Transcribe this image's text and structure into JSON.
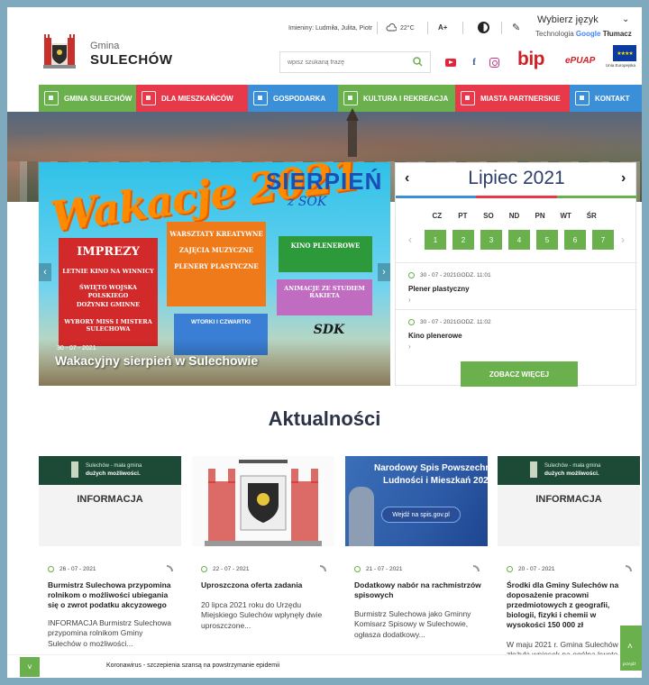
{
  "header": {
    "gmina_label": "Gmina",
    "gmina_name": "SULECHÓW",
    "nameday": "Imieniny: Ludmiła, Julita, Piotr",
    "temperature": "22°C",
    "font_size_label": "A+",
    "language_select": "Wybierz język",
    "translate_prefix": "Technologia ",
    "translate_google": "Google",
    "translate_tlumacz": " Tłumacz",
    "search_placeholder": "wpisz szukaną frazę",
    "bip_label": "bip",
    "epuap_label": "ePUAP",
    "eu_label": "Unia Europejska"
  },
  "nav": [
    {
      "label": "GMINA SULECHÓW",
      "color": "#6ab04c"
    },
    {
      "label": "DLA MIESZKAŃCÓW",
      "color": "#e8394a"
    },
    {
      "label": "GOSPODARKA",
      "color": "#3a8fd8"
    },
    {
      "label": "KULTURA I REKREACJA",
      "color": "#6ab04c"
    },
    {
      "label": "MIASTA PARTNERSKIE",
      "color": "#e8394a"
    },
    {
      "label": "KONTAKT",
      "color": "#3a8fd8"
    }
  ],
  "slider": {
    "title": "Wakacje 2021",
    "month": "SIERPIEŃ",
    "sok": "z SOK",
    "imprezy": "IMPREZY",
    "imprezy_lines": [
      "LETNIE KINO NA WINNICY",
      "ŚWIĘTO WOJSKA POLSKIEGO",
      "DOŻYNKI GMINNE",
      "WYBORY MISS I MISTERA SULECHOWA"
    ],
    "warsztaty": [
      "WARSZTATY KREATYWNE",
      "ZAJĘCIA MUZYCZNE",
      "PLENERY PLASTYCZNE"
    ],
    "kino": "KINO PLENEROWE",
    "animacje": "ANIMACJE ZE STUDIEM RAKIETA",
    "wtorki": "WTORKI I CZWARTKI",
    "sdk": "SDK",
    "date": "30 - 07 - 2021",
    "caption": "Wakacyjny sierpień w Sulechowie",
    "prev": "‹",
    "next": "›"
  },
  "calendar": {
    "title": "Lipiec 2021",
    "prev": "‹",
    "next": "›",
    "days": [
      "CZ",
      "PT",
      "SO",
      "ND",
      "PN",
      "WT",
      "ŚR"
    ],
    "cells": [
      "1",
      "2",
      "3",
      "4",
      "5",
      "6",
      "7"
    ],
    "stripe_colors": [
      "#3a8fd8",
      "#e8394a",
      "#6ab04c"
    ],
    "events": [
      {
        "date": "30 - 07 - 2021GODZ. 11:01",
        "title": "Plener plastyczny"
      },
      {
        "date": "30 - 07 - 2021GODZ. 11:02",
        "title": "Kino plenerowe"
      }
    ],
    "see_more": "ZOBACZ WIĘCEJ"
  },
  "news": {
    "title": "Aktualności",
    "info_top_1": "Sulechów - mała gmina",
    "info_top_2": "dużych możliwości.",
    "info_label": "INFORMACJA",
    "spis_line1": "Narodowy Spis Powszechny",
    "spis_line2": "Ludności i Mieszkań 2021",
    "spis_button": "Wejdź na spis.gov.pl",
    "items": [
      {
        "date": "26 - 07 - 2021",
        "title": "Burmistrz Sulechowa przypomina rolnikom o możliwości ubiegania się o zwrot podatku akcyzowego",
        "body": "INFORMACJA Burmistrz Sulechowa przypomina rolnikom Gminy Sulechów o możliwości..."
      },
      {
        "date": "22 - 07 - 2021",
        "title": "Uproszczona oferta zadania",
        "body": "20 lipca 2021 roku do Urzędu Miejskiego Sulechów wpłynęły dwie uproszczone..."
      },
      {
        "date": "21 - 07 - 2021",
        "title": "Dodatkowy nabór na rachmistrzów spisowych",
        "body": "Burmistrz Sulechowa jako Gminny Komisarz Spisowy w Sulechowie, ogłasza dodatkowy..."
      },
      {
        "date": "20 - 07 - 2021",
        "title": "Środki dla Gminy Sulechów na doposażenie pracowni przedmiotowych z geografii, biologii, fizyki i chemii w wysokości 150 000 zł",
        "body": "W maju 2021 r. Gmina Sulechów złożyła wniosek na ogólną kwotę..."
      }
    ]
  },
  "bottom": {
    "text": "Koronawirus - szczepienia szansą na powstrzymanie epidemii",
    "toggle": "˅",
    "up_label": "przejdź"
  }
}
